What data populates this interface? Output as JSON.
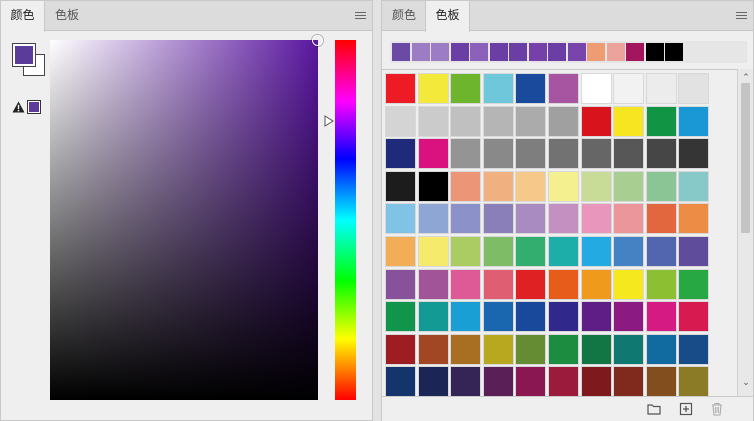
{
  "color_panel": {
    "tabs": [
      {
        "label": "颜色"
      },
      {
        "label": "色板"
      }
    ],
    "active_tab": 0,
    "foreground": "#5b3c9a",
    "background": "#ffffff",
    "hue_color": "#5a16a0",
    "gamut_warning_color": "#5b3c9a",
    "icons": [
      "panel-menu-icon",
      "gamut-warning-icon",
      "hue-slider-arrow-icon"
    ]
  },
  "swatches_panel": {
    "tabs": [
      {
        "label": "颜色"
      },
      {
        "label": "色板"
      }
    ],
    "active_tab": 1,
    "recent": [
      "#6a4aa5",
      "#9b7cc5",
      "#9b7cc5",
      "#6b3ea5",
      "#8c61b9",
      "#6b3ea5",
      "#6b3ea5",
      "#7540aa",
      "#6b3ea5",
      "#7a44ad",
      "#ef9c72",
      "#eba39b",
      "#a3155d",
      "#000000",
      "#000000"
    ],
    "rows": [
      [
        "#ed1c24",
        "#f2e93a",
        "#6cb52d",
        "#6ec7da",
        "#1a4a9c",
        "#a855a1",
        "#ffffff",
        "#f2f2f2",
        "#ececec",
        "#e2e2e2"
      ],
      [
        "#d4d4d4",
        "#cbcbcb",
        "#c0c0c0",
        "#b5b5b5",
        "#ababab",
        "#a0a0a0",
        "#d9131b",
        "#f6e520",
        "#119443",
        "#1a97d5"
      ],
      [
        "#1f2a7a",
        "#d9127f",
        "#949494",
        "#898989",
        "#7e7e7e",
        "#727272",
        "#666666",
        "#575757",
        "#464646",
        "#353535"
      ],
      [
        "#1c1c1c",
        "#000000",
        "#ec9677",
        "#f1b07f",
        "#f6c88a",
        "#f5f08f",
        "#c9dc97",
        "#a8cf91",
        "#8bc595",
        "#86c9c8"
      ],
      [
        "#80c3e7",
        "#8da6d4",
        "#8c92c9",
        "#8b7fb9",
        "#a98bc1",
        "#c48fc1",
        "#e996bd",
        "#ea969a",
        "#e2673f",
        "#ec8c45"
      ],
      [
        "#f2ae56",
        "#f6ea6c",
        "#abcc62",
        "#7fbc66",
        "#34ae6e",
        "#1eaea9",
        "#24aae2",
        "#4582c3",
        "#5166ae",
        "#5f4d9b"
      ],
      [
        "#875299",
        "#a25499",
        "#dd5a96",
        "#df5e72",
        "#e02124",
        "#e85c1b",
        "#ef9a1c",
        "#f5e81f",
        "#8dbf33",
        "#28a843"
      ],
      [
        "#10954a",
        "#139a94",
        "#1a9fd5",
        "#1a67b0",
        "#18499a",
        "#30288a",
        "#5f1d86",
        "#8b1a83",
        "#d51a83",
        "#d71a4f"
      ],
      [
        "#9e1d22",
        "#a24724",
        "#a86e22",
        "#b7a81f",
        "#668c33",
        "#1b8c40",
        "#117643",
        "#0f7870",
        "#126ba0",
        "#174c89"
      ],
      [
        "#14356b",
        "#1c2656",
        "#352456",
        "#5b1f58",
        "#8a1652",
        "#9b1b3c",
        "#7e1a1e",
        "#7f2a1d",
        "#824e1e",
        "#8b7a26"
      ]
    ],
    "icons": [
      "panel-menu-icon",
      "folder-icon",
      "new-swatch-icon",
      "trash-icon",
      "scroll-up-icon",
      "scroll-down-icon"
    ]
  }
}
